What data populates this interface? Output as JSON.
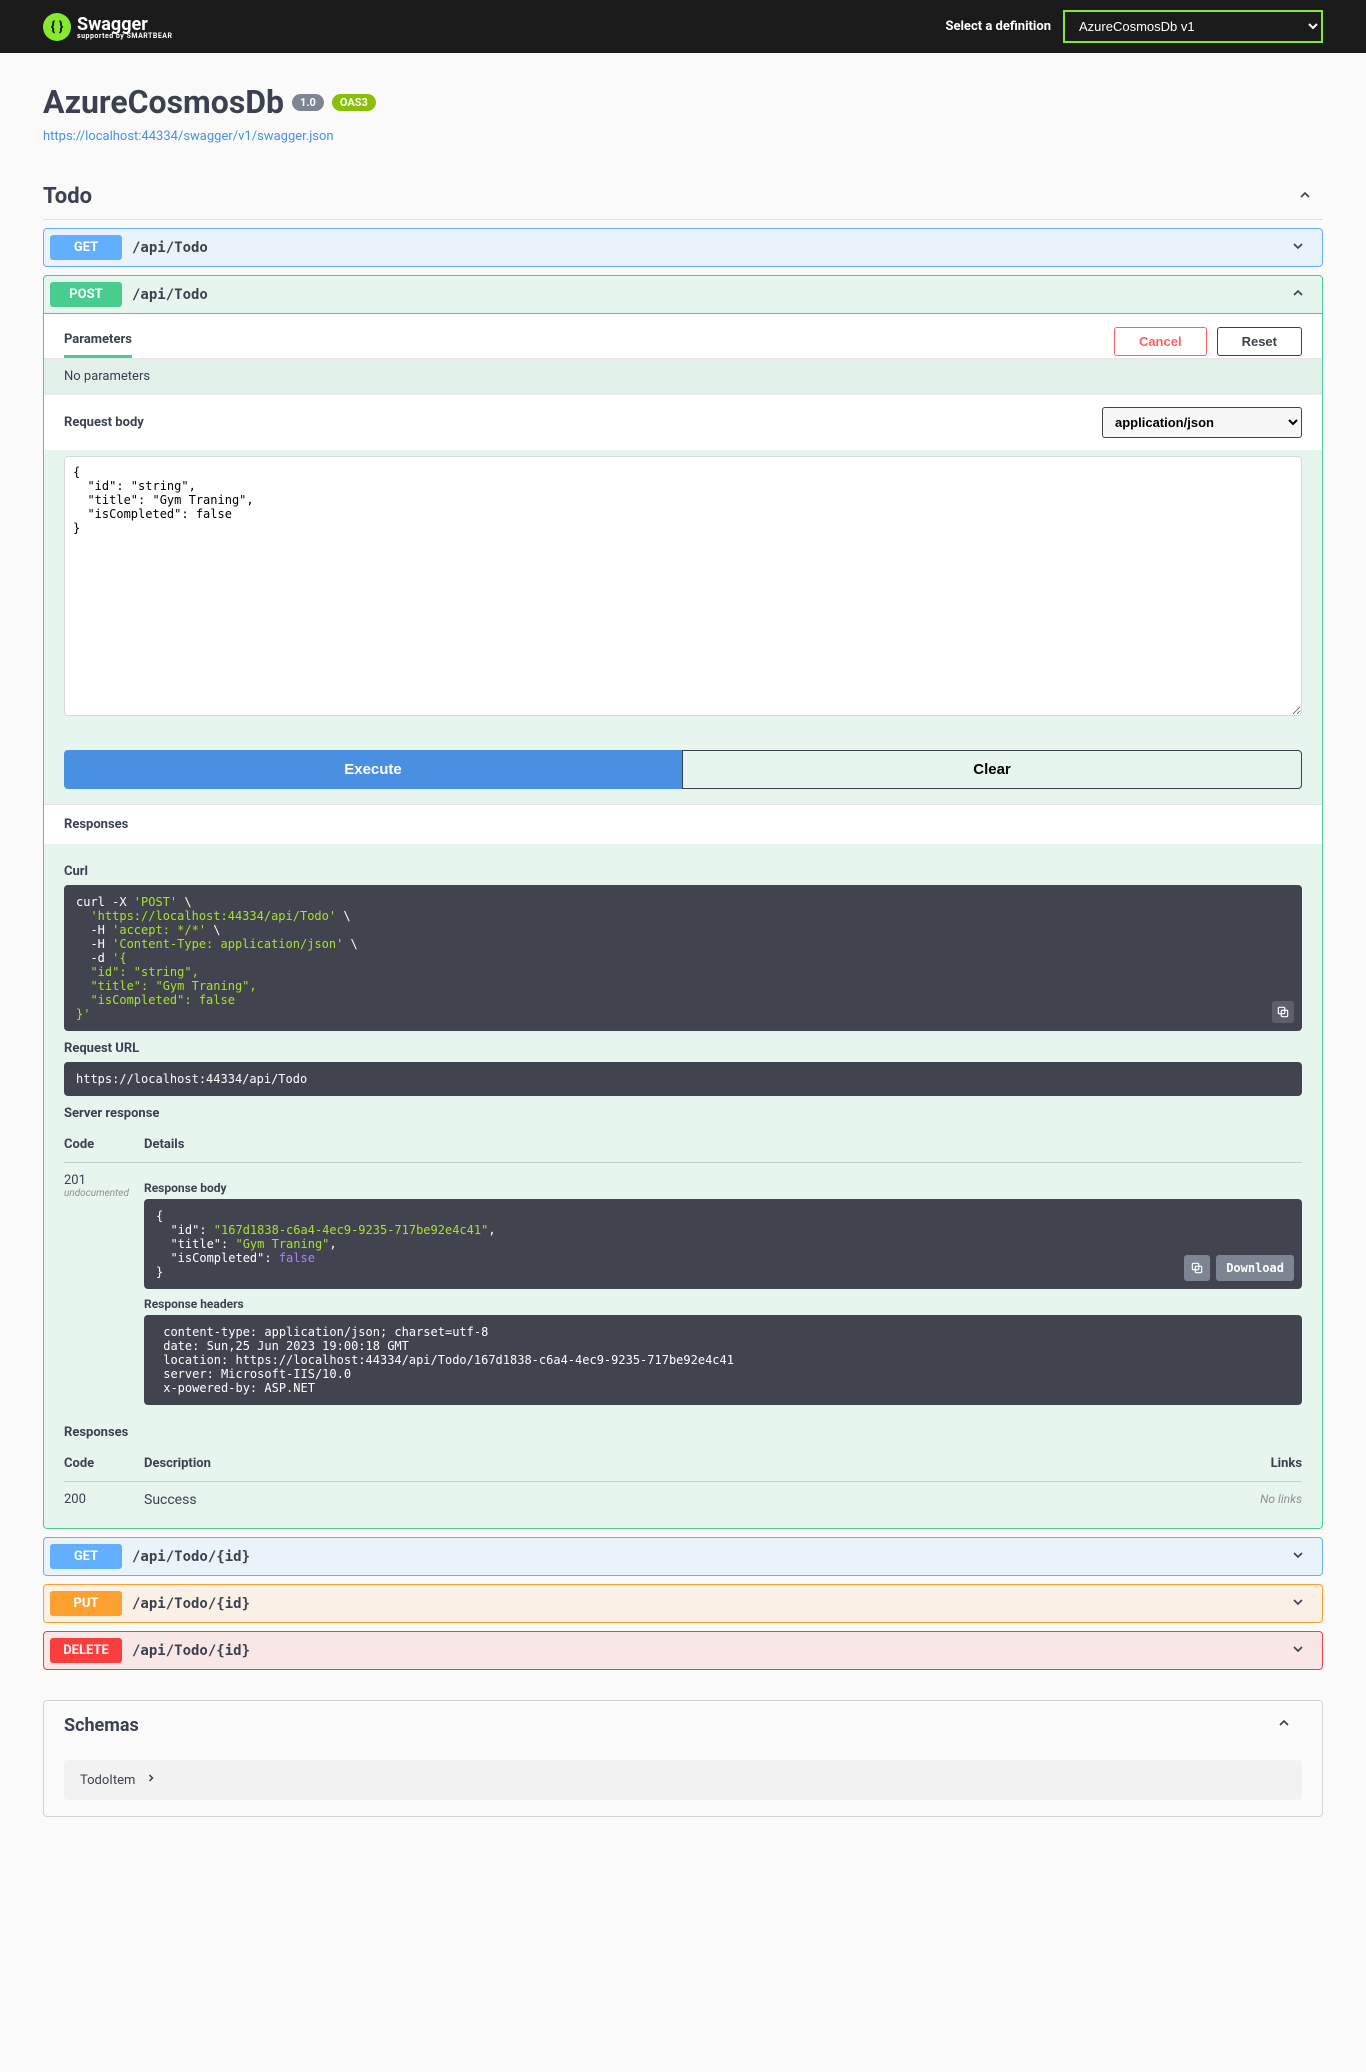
{
  "topbar": {
    "brand": "Swagger",
    "sub": "supported by SMARTBEAR",
    "select_label": "Select a definition",
    "definition": "AzureCosmosDb v1"
  },
  "info": {
    "title": "AzureCosmosDb",
    "version": "1.0",
    "oas": "OAS3",
    "url": "https://localhost:44334/swagger/v1/swagger.json"
  },
  "tag": {
    "name": "Todo"
  },
  "ops": {
    "get_all": {
      "method": "GET",
      "path": "/api/Todo"
    },
    "post": {
      "method": "POST",
      "path": "/api/Todo"
    },
    "get_one": {
      "method": "GET",
      "path": "/api/Todo/{id}"
    },
    "put": {
      "method": "PUT",
      "path": "/api/Todo/{id}"
    },
    "delete": {
      "method": "DELETE",
      "path": "/api/Todo/{id}"
    }
  },
  "params": {
    "tab": "Parameters",
    "cancel": "Cancel",
    "reset": "Reset",
    "none": "No parameters",
    "req_body": "Request body",
    "content_type": "application/json",
    "body_text": "{\n  \"id\": \"string\",\n  \"title\": \"Gym Traning\",\n  \"isCompleted\": false\n}"
  },
  "buttons": {
    "execute": "Execute",
    "clear": "Clear",
    "download": "Download"
  },
  "responses_header": "Responses",
  "curl": {
    "label": "Curl",
    "l1": "curl -X ",
    "l1b": "'POST'",
    "l2": "  'https://localhost:44334/api/Todo'",
    "l3a": "  -H ",
    "l3b": "'accept: */*'",
    "l4b": "'Content-Type: application/json'",
    "l5": "  -d ",
    "l5b": "'{",
    "l6": "  \"id\": \"string\",",
    "l7": "  \"title\": \"Gym Traning\",",
    "l8": "  \"isCompleted\": false",
    "l9": "}'"
  },
  "req_url": {
    "label": "Request URL",
    "value": "https://localhost:44334/api/Todo"
  },
  "server_resp": {
    "label": "Server response",
    "code_h": "Code",
    "details_h": "Details",
    "code": "201",
    "undoc": "undocumented",
    "body_label": "Response body",
    "body_l1": "{",
    "body_l2a": "  \"id\": ",
    "body_l2b": "\"167d1838-c6a4-4ec9-9235-717be92e4c41\"",
    "body_l3a": "  \"title\": ",
    "body_l3b": "\"Gym Traning\"",
    "body_l4a": "  \"isCompleted\": ",
    "body_l4b": "false",
    "body_l5": "}",
    "headers_label": "Response headers",
    "headers_text": " content-type: application/json; charset=utf-8 \n date: Sun,25 Jun 2023 19:00:18 GMT \n location: https://localhost:44334/api/Todo/167d1838-c6a4-4ec9-9235-717be92e4c41 \n server: Microsoft-IIS/10.0 \n x-powered-by: ASP.NET "
  },
  "doc_resp": {
    "label": "Responses",
    "code_h": "Code",
    "desc_h": "Description",
    "links_h": "Links",
    "code": "200",
    "desc": "Success",
    "nolinks": "No links"
  },
  "schemas": {
    "header": "Schemas",
    "item": "TodoItem"
  }
}
